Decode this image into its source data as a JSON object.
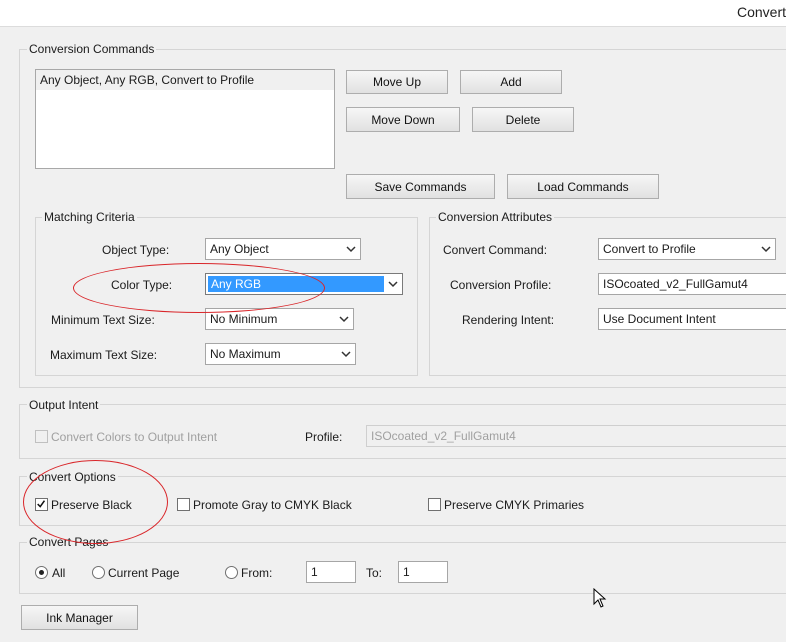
{
  "window": {
    "title": "Convert"
  },
  "conversion_commands": {
    "legend": "Conversion Commands",
    "items": [
      "Any Object, Any RGB, Convert to Profile"
    ],
    "buttons": {
      "move_up": "Move Up",
      "add": "Add",
      "move_down": "Move Down",
      "delete": "Delete",
      "save": "Save Commands",
      "load": "Load Commands"
    }
  },
  "matching_criteria": {
    "legend": "Matching Criteria",
    "object_type": {
      "label": "Object Type:",
      "value": "Any Object"
    },
    "color_type": {
      "label": "Color Type:",
      "value": "Any RGB"
    },
    "min_text_size": {
      "label": "Minimum Text Size:",
      "value": "No Minimum"
    },
    "max_text_size": {
      "label": "Maximum Text Size:",
      "value": "No Maximum"
    }
  },
  "conversion_attributes": {
    "legend": "Conversion Attributes",
    "convert_command": {
      "label": "Convert Command:",
      "value": "Convert to Profile"
    },
    "conversion_profile": {
      "label": "Conversion Profile:",
      "value": "ISOcoated_v2_FullGamut4"
    },
    "rendering_intent": {
      "label": "Rendering Intent:",
      "value": "Use Document Intent"
    }
  },
  "output_intent": {
    "legend": "Output Intent",
    "convert_colors_label": "Convert Colors to Output Intent",
    "profile_label": "Profile:",
    "profile_value": "ISOcoated_v2_FullGamut4"
  },
  "convert_options": {
    "legend": "Convert Options",
    "preserve_black": "Preserve Black",
    "promote_gray": "Promote Gray to CMYK Black",
    "preserve_cmyk": "Preserve CMYK Primaries"
  },
  "convert_pages": {
    "legend": "Convert Pages",
    "all": "All",
    "current": "Current Page",
    "from": "From:",
    "from_value": "1",
    "to": "To:",
    "to_value": "1"
  },
  "ink_manager": "Ink Manager",
  "colors": {
    "highlight": "#3399ff",
    "annotation_red": "#d9262a"
  }
}
